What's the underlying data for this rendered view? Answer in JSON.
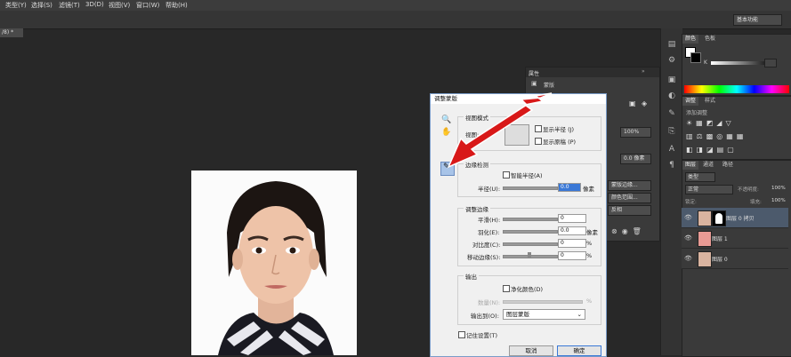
{
  "menu": [
    "类型(Y)",
    "选择(S)",
    "滤镜(T)",
    "3D(D)",
    "视图(V)",
    "窗口(W)",
    "帮助(H)"
  ],
  "workspace": "基本功能",
  "doc_tab": "/8) *",
  "properties": {
    "title": "属性",
    "subtitle": "蒙版",
    "pct1": "100%",
    "pct2": "0.0 像素",
    "btn_edge": "蒙版边缘...",
    "btn_color": "颜色范围...",
    "btn_invert": "反相"
  },
  "color_panel": {
    "tabs": [
      "颜色",
      "色板"
    ],
    "k_label": "K"
  },
  "adjust_panel": {
    "tabs": [
      "调整",
      "样式"
    ],
    "hint": "添加调整"
  },
  "layers_panel": {
    "tabs": [
      "图层",
      "通道",
      "路径"
    ],
    "filter": "类型",
    "blend": "正常",
    "opacity_label": "不透明度:",
    "opacity": "100%",
    "lock_label": "锁定:",
    "fill_label": "填充:",
    "fill": "100%",
    "layers": [
      {
        "name": "图层 0 拷贝",
        "selected": true
      },
      {
        "name": "图层 1",
        "selected": false
      },
      {
        "name": "图层 0",
        "selected": false
      }
    ]
  },
  "dialog": {
    "title": "调整蒙版",
    "view_group": "视图模式",
    "view_label": "视图:",
    "show_radius": "显示半径 (J)",
    "show_original": "显示原稿 (P)",
    "edge_group": "边缘检测",
    "smart_radius": "智能半径(A)",
    "radius_label": "半径(U):",
    "radius_value": "0.0",
    "radius_unit": "像素",
    "adjust_group": "调整边缘",
    "smooth_label": "平滑(H):",
    "smooth_value": "0",
    "feather_label": "羽化(E):",
    "feather_value": "0.0",
    "feather_unit": "像素",
    "contrast_label": "对比度(C):",
    "contrast_value": "0",
    "contrast_unit": "%",
    "shift_label": "移动边缘(S):",
    "shift_value": "0",
    "shift_unit": "%",
    "output_group": "输出",
    "decontam": "净化颜色(D)",
    "amount_label": "数量(N):",
    "amount_unit": "%",
    "output_to_label": "输出到(O):",
    "output_to": "图层蒙版",
    "remember": "记住设置(T)",
    "cancel": "取消",
    "ok": "确定"
  }
}
